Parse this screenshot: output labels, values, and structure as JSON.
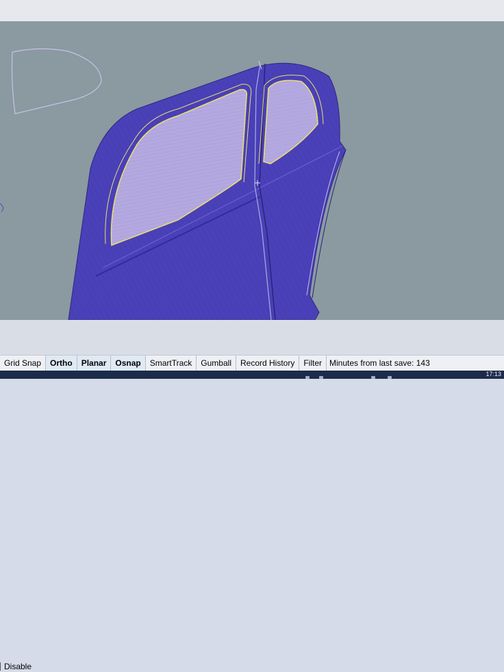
{
  "osnap_panel": {
    "disable_label": "Disable"
  },
  "status_bar": {
    "panes": [
      {
        "label": "Grid Snap",
        "active": false
      },
      {
        "label": "Ortho",
        "active": true
      },
      {
        "label": "Planar",
        "active": true
      },
      {
        "label": "Osnap",
        "active": true
      },
      {
        "label": "SmartTrack",
        "active": false
      },
      {
        "label": "Gumball",
        "active": false
      },
      {
        "label": "Record History",
        "active": false
      },
      {
        "label": "Filter",
        "active": false
      }
    ],
    "message": "Minutes from last save: 143"
  },
  "taskbar": {
    "clock": "17:13"
  },
  "colors": {
    "viewport_background": "#8a9aa0",
    "body_surface": "#4a40b8",
    "glass": "#b4a8e0",
    "selection_highlight": "#e8e070",
    "curve": "#c8c0e8"
  }
}
